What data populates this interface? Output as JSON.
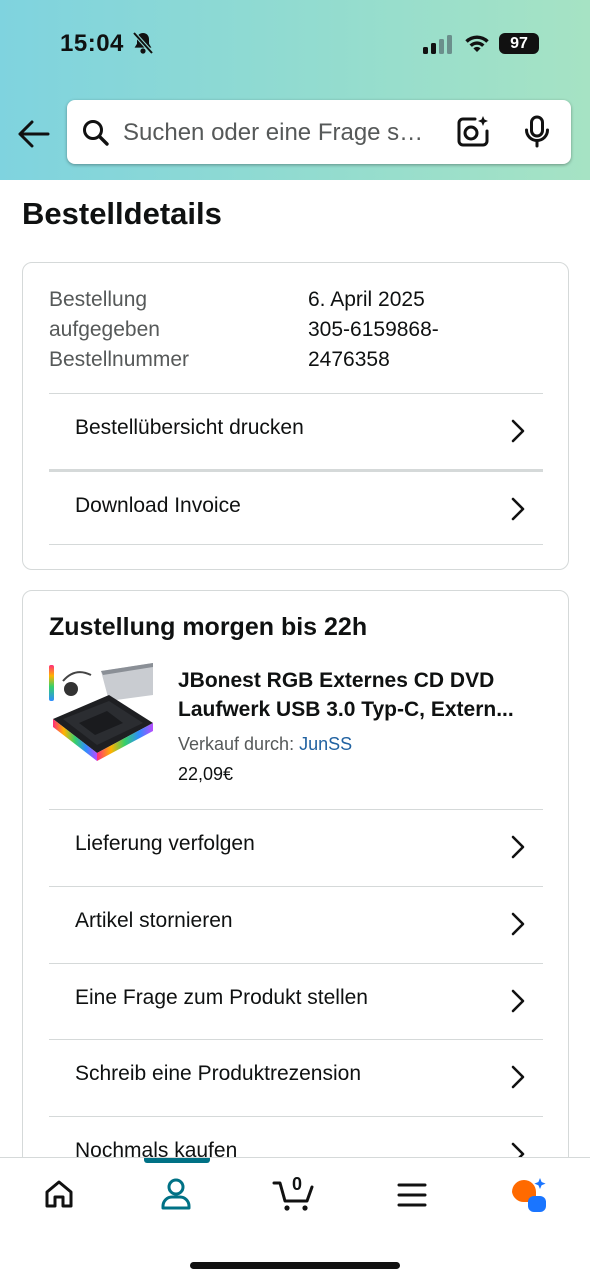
{
  "status_bar": {
    "time": "15:04",
    "battery": "97"
  },
  "search": {
    "placeholder": "Suchen oder eine Frage s…"
  },
  "page": {
    "title": "Bestelldetails"
  },
  "order_info": {
    "labels": [
      "Bestellung",
      "aufgegeben",
      "Bestellnummer"
    ],
    "values": [
      "6. April 2025",
      "305-6159868-",
      "2476358"
    ]
  },
  "order_actions": [
    {
      "label": "Bestellübersicht drucken"
    },
    {
      "label": "Download Invoice"
    }
  ],
  "shipment": {
    "heading": "Zustellung morgen bis 22h",
    "product_title": "JBonest RGB Externes CD DVD Laufwerk USB 3.0 Typ-C, Extern...",
    "sold_by_label": "Verkauf durch: ",
    "seller": "JunSS",
    "price": "22,09€",
    "actions": [
      {
        "label": "Lieferung verfolgen"
      },
      {
        "label": "Artikel stornieren"
      },
      {
        "label": "Eine Frage zum Produkt stellen"
      },
      {
        "label": "Schreib eine Produktrezension"
      },
      {
        "label": "Nochmals kaufen"
      }
    ]
  },
  "tabbar": {
    "cart_count": "0",
    "items": [
      {
        "icon": "home-icon"
      },
      {
        "icon": "user-icon",
        "active": true
      },
      {
        "icon": "cart-icon"
      },
      {
        "icon": "menu-icon"
      },
      {
        "icon": "rufus-icon"
      }
    ]
  },
  "colors": {
    "accent": "#007185",
    "link": "#2162a1",
    "header_start": "#7fd3df",
    "header_end": "#a6e3c4"
  }
}
